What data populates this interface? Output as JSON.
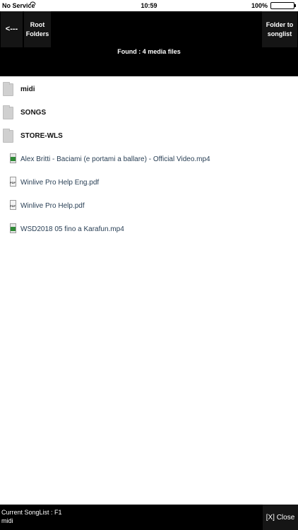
{
  "status_bar": {
    "carrier": "No Service",
    "wifi_icon": "wifi-icon",
    "time": "10:59",
    "battery_pct": "100%",
    "battery_color": "#2cc34b"
  },
  "toolbar": {
    "back_label": "<---",
    "root_label": "Root\nFolders",
    "folder_to_songlist_label": "Folder to\nsonglist"
  },
  "found_text": "Found : 4 media files",
  "items": [
    {
      "label": "midi",
      "icon": "folder-icon"
    },
    {
      "label": "SONGS",
      "icon": "folder-icon"
    },
    {
      "label": "STORE-WLS",
      "icon": "folder-icon"
    },
    {
      "label": "Alex Britti - Baciami (e portami a ballare) - Official Video.mp4",
      "icon": "video-file-icon"
    },
    {
      "label": "Winlive Pro Help Eng.pdf",
      "icon": "pdf-file-icon"
    },
    {
      "label": "Winlive Pro Help.pdf",
      "icon": "pdf-file-icon"
    },
    {
      "label": "WSD2018 05 fino a Karafun.mp4",
      "icon": "video-file-icon"
    }
  ],
  "footer": {
    "current_songlist": "Current SongList : F1",
    "current_folder": "midi",
    "close_label": "[X] Close"
  }
}
